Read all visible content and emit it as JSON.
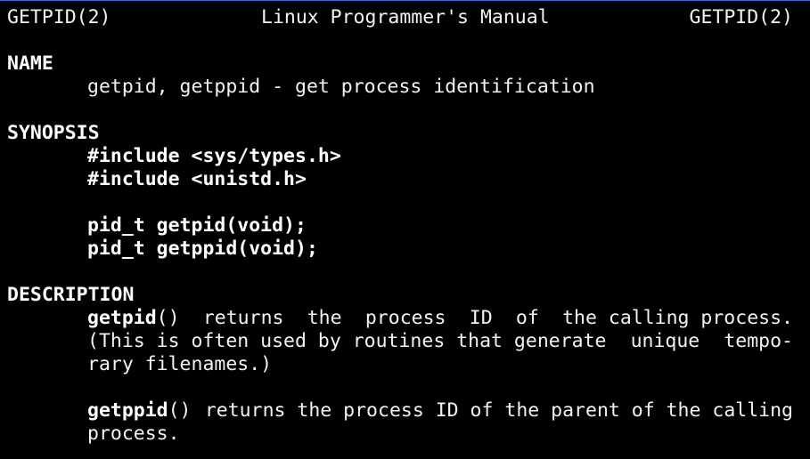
{
  "header": {
    "left": "GETPID(2)",
    "center": "Linux Programmer's Manual",
    "right": "GETPID(2)"
  },
  "sections": {
    "name": {
      "heading": "NAME",
      "text": "getpid, getppid - get process identification"
    },
    "synopsis": {
      "heading": "SYNOPSIS",
      "include1": "#include <sys/types.h>",
      "include2": "#include <unistd.h>",
      "proto1": "pid_t getpid(void);",
      "proto2": "pid_t getppid(void);"
    },
    "description": {
      "heading": "DESCRIPTION",
      "p1_line1_words": [
        "getpid",
        "()",
        "returns",
        "the",
        "process",
        "ID",
        "of",
        "the calling process."
      ],
      "p1_line2_words": [
        "(This is often used by routines that generate",
        "unique",
        "tempo-"
      ],
      "p1_line3": "rary filenames.)",
      "p2_line1_words": [
        "getppid",
        "()",
        "returns the process ID of the parent of the calling"
      ],
      "p2_line2": "process."
    }
  },
  "colors": {
    "background": "#000000",
    "text": "#f2f2f2",
    "top_border": "#2a6fd6"
  }
}
